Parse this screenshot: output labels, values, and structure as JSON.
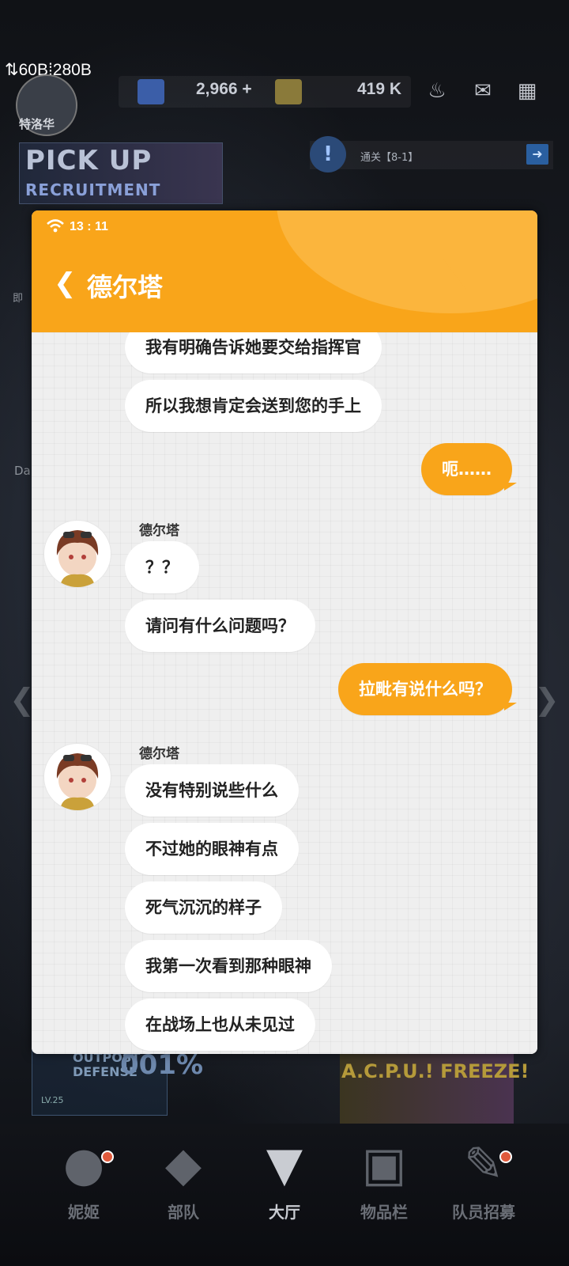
{
  "status_bar": {
    "network": "⇅60B⁞280B"
  },
  "top_bar": {
    "player_name": "特洛华",
    "gems": "2,966 +",
    "credits": "419 K"
  },
  "home_background": {
    "banner_title": "PICK UP",
    "banner_subtitle": "RECRUITMENT",
    "mission_text": "通关【8-1】",
    "outpost_title_line1": "OUTPOST",
    "outpost_title_line2": "DEFENSE",
    "outpost_percent": "001%",
    "outpost_level": "LV.25",
    "event_label": "A.C.P.U.! FREEZE!",
    "partial_left_1": "即",
    "partial_left_2": "Da"
  },
  "nav": {
    "items": [
      {
        "label": "妮姬",
        "icon": "nikke-icon"
      },
      {
        "label": "部队",
        "icon": "squad-icon"
      },
      {
        "label": "大厅",
        "icon": "lobby-icon"
      },
      {
        "label": "物品栏",
        "icon": "inventory-icon"
      },
      {
        "label": "队员招募",
        "icon": "recruit-icon"
      }
    ],
    "active": "大厅"
  },
  "phone": {
    "time": "13 : 11",
    "chat_title": "德尔塔",
    "messages": [
      {
        "from": "德尔塔",
        "text": "我有明确告诉她要交给指挥官"
      },
      {
        "from": "德尔塔",
        "text": "所以我想肯定会送到您的手上"
      },
      {
        "from": "me",
        "text": "呃……"
      },
      {
        "from": "德尔塔",
        "sender_label": "德尔塔",
        "text": "？？"
      },
      {
        "from": "德尔塔",
        "text": "请问有什么问题吗？"
      },
      {
        "from": "me",
        "text": "拉毗有说什么吗？"
      },
      {
        "from": "德尔塔",
        "sender_label": "德尔塔",
        "text": "没有特别说些什么"
      },
      {
        "from": "德尔塔",
        "text": "不过她的眼神有点"
      },
      {
        "from": "德尔塔",
        "text": "死气沉沉的样子"
      },
      {
        "from": "德尔塔",
        "text": "我第一次看到那种眼神"
      },
      {
        "from": "德尔塔",
        "text": "在战场上也从未见过"
      }
    ]
  },
  "colors": {
    "accent": "#f9a51a",
    "bubble_other": "#ffffff",
    "chat_bg": "#efefef"
  }
}
